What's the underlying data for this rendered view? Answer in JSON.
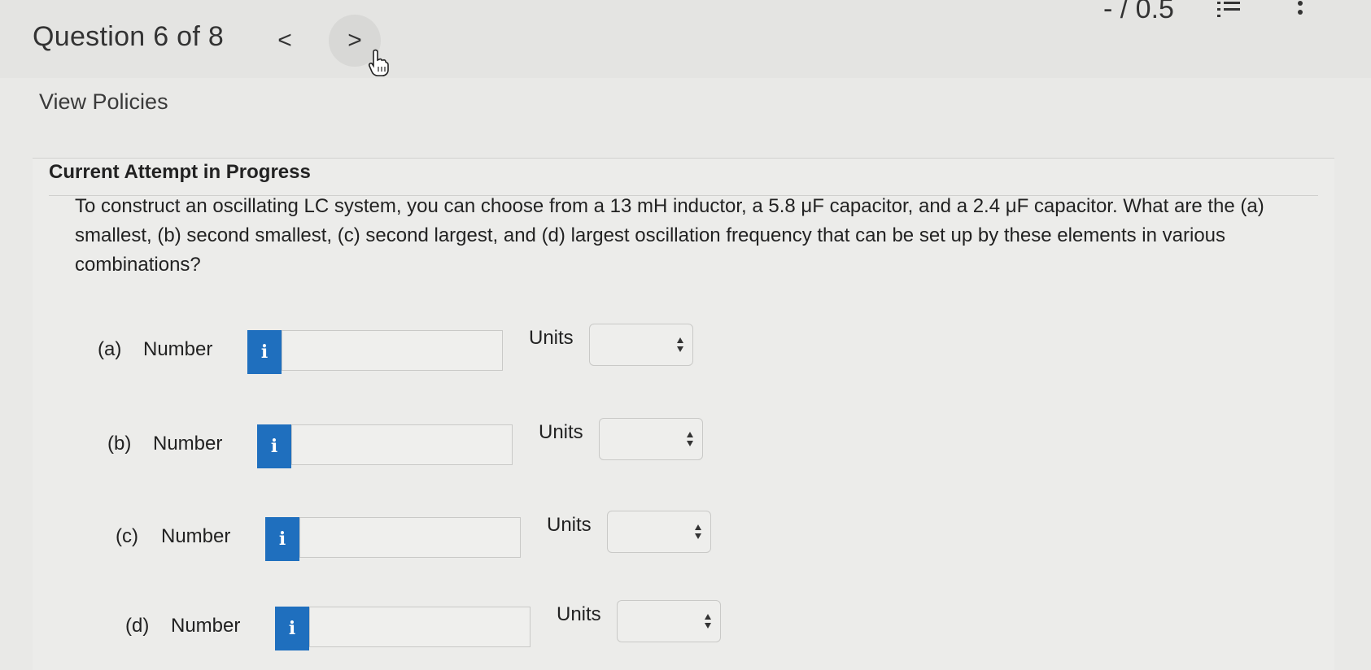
{
  "header": {
    "question_label": "Question 6 of 8",
    "prev_symbol": "<",
    "next_symbol": ">",
    "score": "- / 0.5"
  },
  "policies_link": "View Policies",
  "attempt_heading": "Current Attempt in Progress",
  "question_text": "To construct an oscillating LC system, you can choose from a 13 mH inductor, a 5.8 μF capacitor, and a 2.4 μF capacitor. What are the (a) smallest, (b) second smallest, (c) second largest, and (d) largest oscillation frequency that can be set up by these elements in various combinations?",
  "answers": [
    {
      "part": "(a)",
      "label": "Number",
      "info": "i",
      "value": "",
      "units_label": "Units",
      "units_value": ""
    },
    {
      "part": "(b)",
      "label": "Number",
      "info": "i",
      "value": "",
      "units_label": "Units",
      "units_value": ""
    },
    {
      "part": "(c)",
      "label": "Number",
      "info": "i",
      "value": "",
      "units_label": "Units",
      "units_value": ""
    },
    {
      "part": "(d)",
      "label": "Number",
      "info": "i",
      "value": "",
      "units_label": "Units",
      "units_value": ""
    }
  ],
  "colors": {
    "info_button": "#1f6fbe",
    "background": "#e9e9e7"
  },
  "icons": [
    "list-icon",
    "more-vertical-icon",
    "hand-cursor-icon"
  ]
}
